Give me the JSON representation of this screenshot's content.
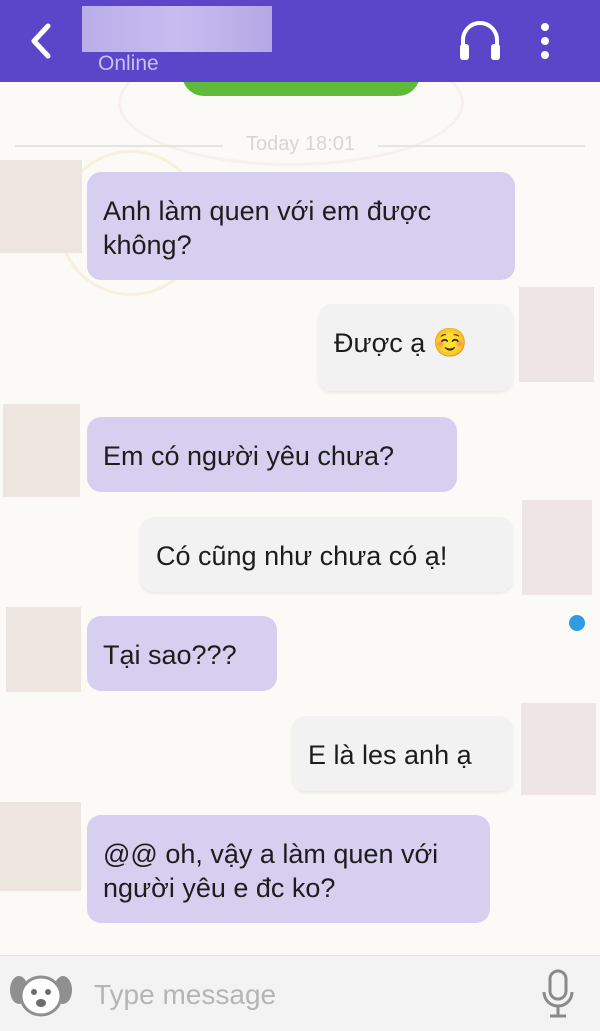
{
  "header": {
    "contact_status": "Online",
    "icons": {
      "back": "back-arrow-icon",
      "call": "headset-icon",
      "more": "more-vertical-icon"
    }
  },
  "conversation": {
    "date_divider": "Today 18:01",
    "messages": [
      {
        "direction": "incoming",
        "text": "Anh làm quen với em được không?"
      },
      {
        "direction": "outgoing",
        "text": "Được ạ",
        "emoji": "☺️"
      },
      {
        "direction": "incoming",
        "text": "Em có người yêu chưa?"
      },
      {
        "direction": "outgoing",
        "text": "Có cũng như chưa có ạ!"
      },
      {
        "direction": "incoming",
        "text": "Tại sao???"
      },
      {
        "direction": "outgoing",
        "text": "E là les anh ạ"
      },
      {
        "direction": "incoming",
        "text": "@@ oh, vậy a làm quen với người yêu e đc ko?"
      }
    ]
  },
  "composer": {
    "placeholder": "Type message",
    "icons": {
      "sticker": "dog-sticker-icon",
      "mic": "microphone-icon"
    }
  },
  "colors": {
    "header_bg": "#5b46c9",
    "incoming_bubble": "#d6cff0",
    "outgoing_bubble": "#f2f2f2",
    "banner_green": "#5fba3a",
    "unread_dot": "#2f9be0"
  }
}
